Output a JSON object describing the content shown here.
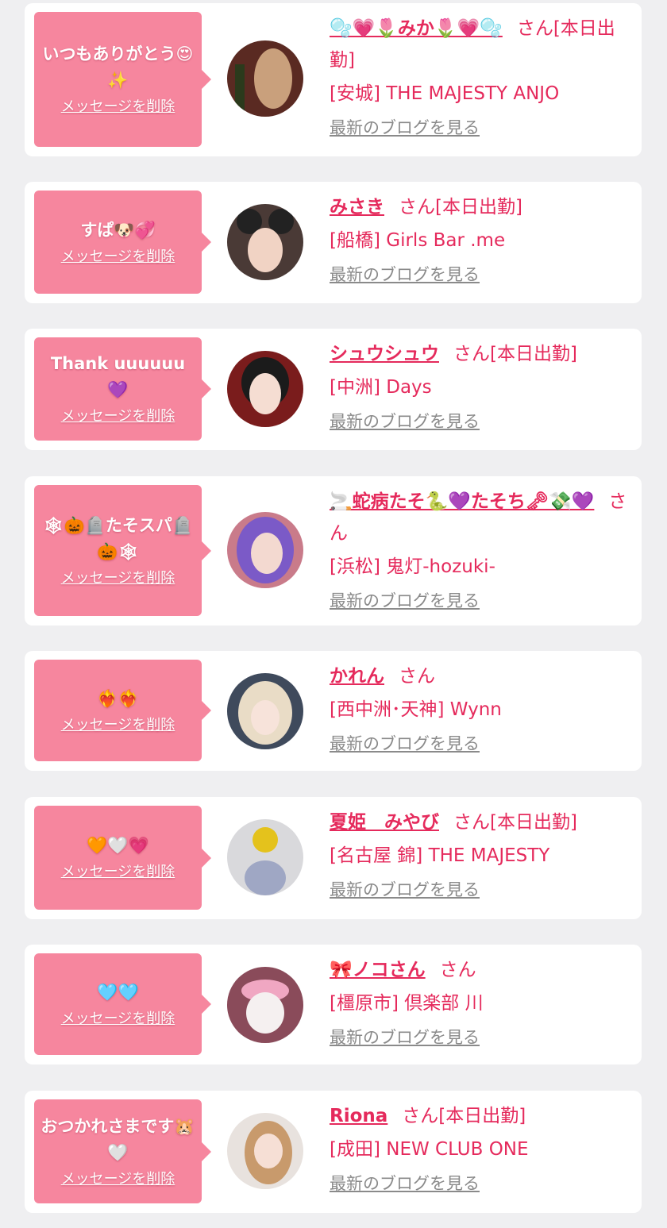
{
  "list": {
    "delete_label": "メッセージを削除",
    "blog_label": "最新のブログを見る",
    "san_label": "さん",
    "attendance_label": "[本日出勤]",
    "items": [
      {
        "message": "いつもありがとう😍✨",
        "name": "🫧💗🌷みか🌷💗🫧",
        "attendance": "[本日出勤]",
        "shop": "[安城] THE MAJESTY ANJO"
      },
      {
        "message": "すぱ🐶💞",
        "name": "みさき",
        "attendance": "[本日出勤]",
        "shop": "[船橋] Girls Bar .me"
      },
      {
        "message": "Thank uuuuuu💜",
        "name": "シュウシュウ",
        "attendance": "[本日出勤]",
        "shop": "[中洲] Days"
      },
      {
        "message": "🕸🎃🪦たそスパ🪦🎃🕸",
        "name": "🚬蛇病たそ🐍💜たそち🗝💸💜",
        "attendance": "",
        "shop": "[浜松] 鬼灯-hozuki-"
      },
      {
        "message": "❤️‍🔥❤️‍🔥",
        "name": "かれん",
        "attendance": "",
        "shop": "[西中洲･天神] Wynn"
      },
      {
        "message": "🧡🤍💗",
        "name": "夏姫　みやび",
        "attendance": "[本日出勤]",
        "shop": "[名古屋 錦] THE MAJESTY"
      },
      {
        "message": "🩵🩵",
        "name": "🎀ノコさん",
        "attendance": "",
        "shop": "[橿原市] 倶楽部 川"
      },
      {
        "message": "おつかれさまです🐹🤍",
        "name": "Riona",
        "attendance": "[本日出勤]",
        "shop": "[成田] NEW CLUB ONE"
      }
    ]
  },
  "colors": {
    "bubble": "#f6869e",
    "accent_text": "#e52a5c",
    "link_gray": "#8a8a8a",
    "background": "#efeff1"
  }
}
